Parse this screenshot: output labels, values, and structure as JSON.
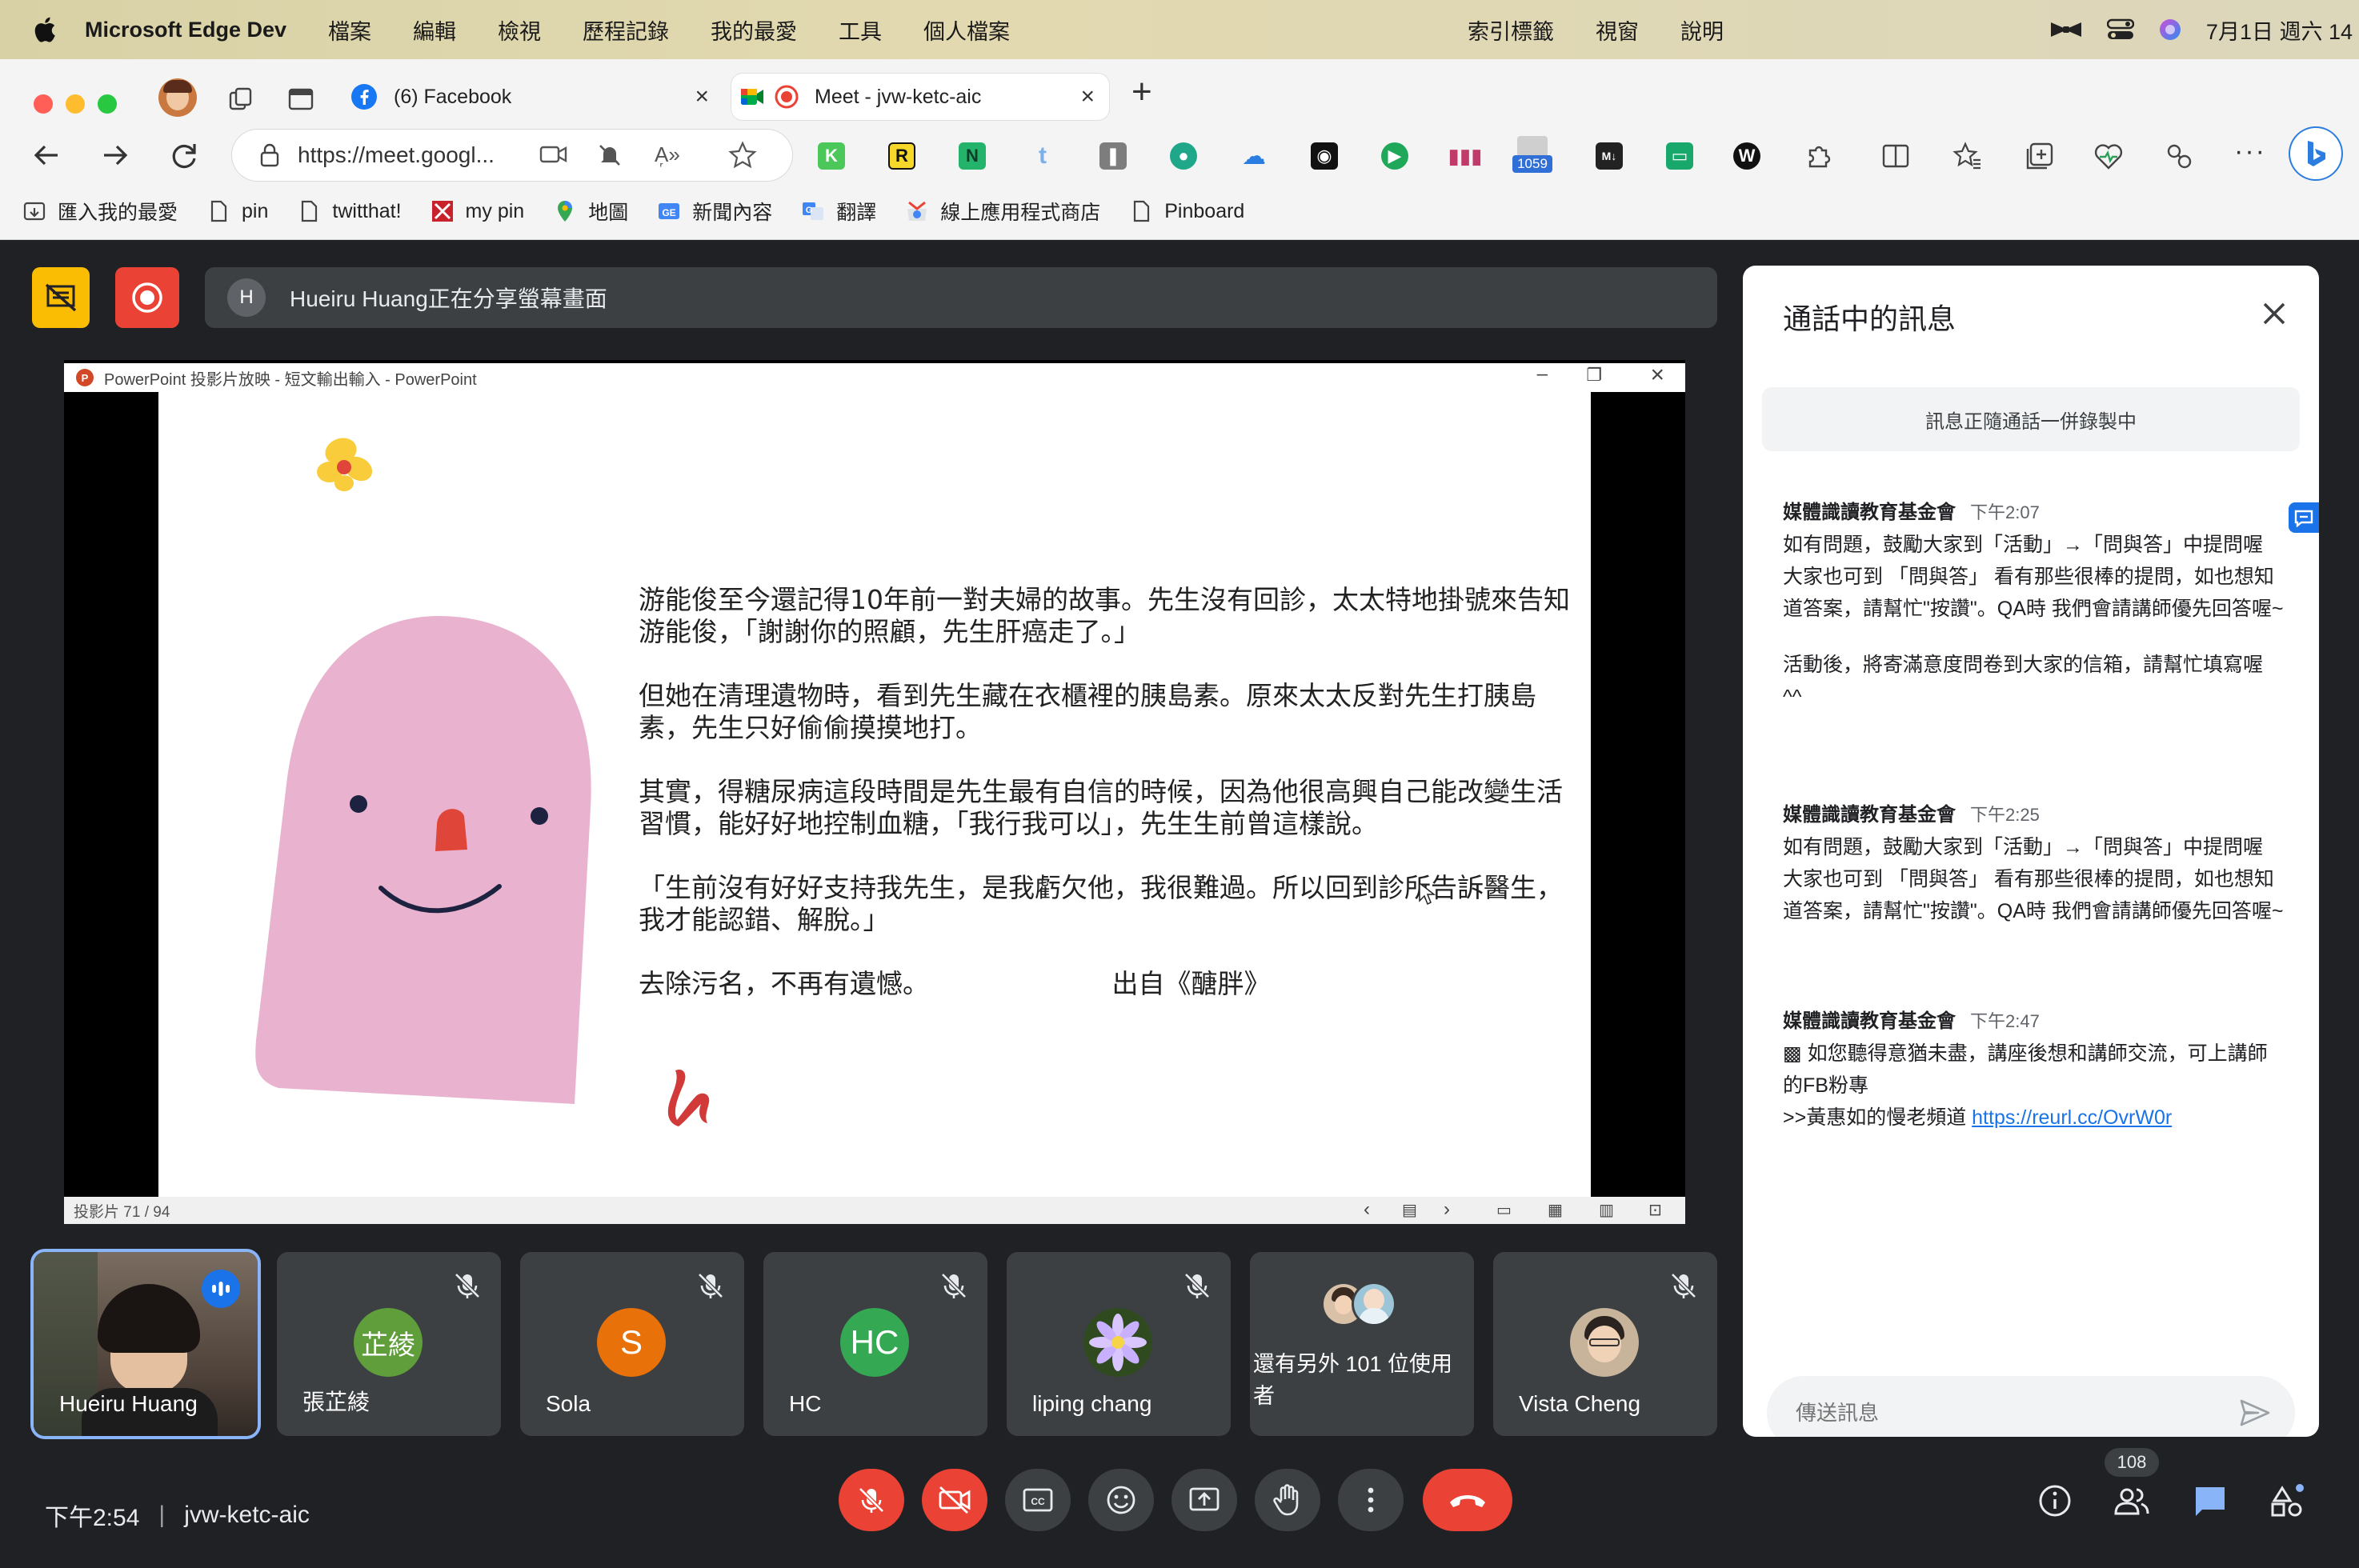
{
  "menubar": {
    "app_name": "Microsoft Edge Dev",
    "items": [
      "檔案",
      "編輯",
      "檢視",
      "歷程記錄",
      "我的最愛",
      "工具",
      "個人檔案"
    ],
    "items_right": [
      "索引標籤",
      "視窗",
      "說明"
    ],
    "datetime": "7月1日 週六 14"
  },
  "browser": {
    "tabs": [
      {
        "label": "(6) Facebook"
      },
      {
        "label": "Meet - jvw-ketc-aic"
      }
    ],
    "url": "https://meet.googl...",
    "ext_badge": "1059",
    "bookmarks": [
      "匯入我的最愛",
      "pin",
      "twitthat!",
      "my pin",
      "地圖",
      "新聞內容",
      "翻譯",
      "線上應用程式商店",
      "Pinboard"
    ],
    "ext_letters": [
      "K",
      "R",
      "N"
    ]
  },
  "meet": {
    "share_avatar": "H",
    "share_banner": "Hueiru Huang正在分享螢幕畫面",
    "ppt_window_title": "PowerPoint 投影片放映  -  短文輸出輸入 - PowerPoint",
    "slide_paragraphs": [
      "游能俊至今還記得10年前一對夫婦的故事。先生沒有回診，太太特地掛號來告知游能俊，「謝謝你的照顧，先生肝癌走了。」",
      "但她在清理遺物時，看到先生藏在衣櫃裡的胰島素。原來太太反對先生打胰島素，先生只好偷偷摸摸地打。",
      "其實，得糖尿病這段時間是先生最有自信的時候，因為他很高興自己能改變生活習慣，能好好地控制血糖，「我行我可以」，先生生前曾這樣說。",
      "「生前沒有好好支持我先生，是我虧欠他，我很難過。所以回到診所告訴醫生，我才能認錯、解脫。」"
    ],
    "slide_last_line": "去除污名，不再有遺憾。",
    "slide_source": "出自《醣胖》",
    "slide_counter": "投影片 71 / 94",
    "participants": [
      {
        "name": "Hueiru Huang",
        "avatar": ""
      },
      {
        "name": "張芷綾",
        "avatar": "芷綾",
        "color": "#5f9e3b"
      },
      {
        "name": "Sola",
        "avatar": "S",
        "color": "#e8710a"
      },
      {
        "name": "HC",
        "avatar": "HC",
        "color": "#34a853"
      },
      {
        "name": "liping chang",
        "avatar": ""
      },
      {
        "name": "還有另外 101 位使用者",
        "avatar": ""
      },
      {
        "name": "Vista Cheng",
        "avatar": ""
      }
    ],
    "time": "下午2:54",
    "meeting_code": "jvw-ketc-aic",
    "people_count": "108"
  },
  "chat": {
    "title": "通話中的訊息",
    "recording_note": "訊息正隨通話一併錄製中",
    "messages": [
      {
        "sender": "媒體識讀教育基金會",
        "time": "下午2:07",
        "body1": "如有問題，鼓勵大家到「活動」→「問與答」中提問喔 大家也可到 「問與答」 看有那些很棒的提問，如也想知道答案，請幫忙\"按讚\"。QA時 我們會請講師優先回答喔~",
        "body2": "活動後，將寄滿意度問卷到大家的信箱，請幫忙填寫喔 ^^"
      },
      {
        "sender": "媒體識讀教育基金會",
        "time": "下午2:25",
        "body1": "如有問題，鼓勵大家到「活動」→「問與答」中提問喔 大家也可到 「問與答」 看有那些很棒的提問，如也想知道答案，請幫忙\"按讚\"。QA時 我們會請講師優先回答喔~"
      },
      {
        "sender": "媒體識讀教育基金會",
        "time": "下午2:47",
        "body1": "▩ 如您聽得意猶未盡，講座後想和講師交流，可上講師的FB粉專",
        "body2": " >>黃惠如的慢老頻道 ",
        "link": "https://reurl.cc/OvrW0r"
      }
    ],
    "input_placeholder": "傳送訊息"
  }
}
